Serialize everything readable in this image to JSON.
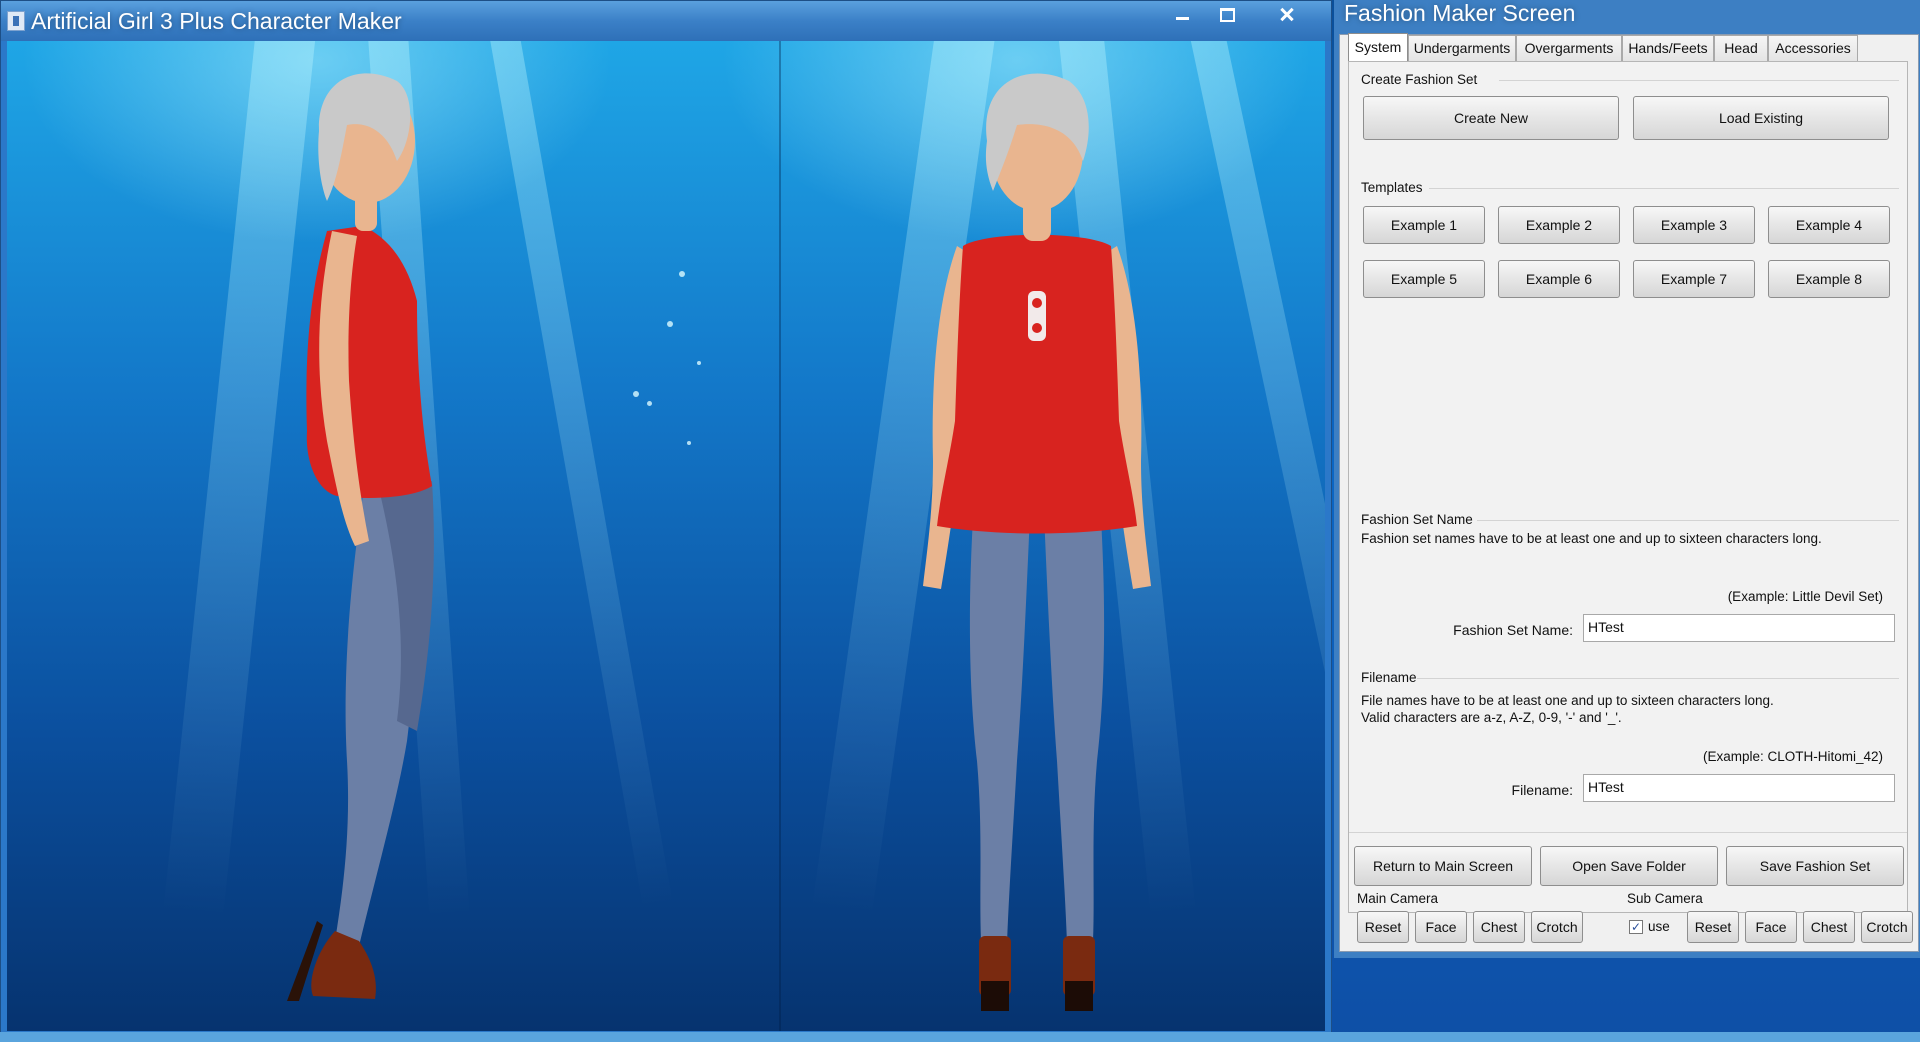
{
  "main_window": {
    "title": "Artificial Girl 3 Plus Character Maker"
  },
  "panel": {
    "title": "Fashion Maker Screen",
    "tabs": [
      {
        "label": "System",
        "active": true
      },
      {
        "label": "Undergarments",
        "active": false
      },
      {
        "label": "Overgarments",
        "active": false
      },
      {
        "label": "Hands/Feets",
        "active": false
      },
      {
        "label": "Head",
        "active": false
      },
      {
        "label": "Accessories",
        "active": false
      }
    ],
    "create_group": {
      "label": "Create Fashion Set",
      "create_new": "Create New",
      "load_existing": "Load Existing"
    },
    "templates": {
      "label": "Templates",
      "buttons": [
        "Example 1",
        "Example 2",
        "Example 3",
        "Example 4",
        "Example 5",
        "Example 6",
        "Example 7",
        "Example 8"
      ]
    },
    "fashion_set_name": {
      "group_label": "Fashion Set Name",
      "description": "Fashion set names have to be at least one and up to sixteen characters long.",
      "example": "(Example: Little Devil Set)",
      "field_label": "Fashion Set Name:",
      "value": "HTest"
    },
    "filename": {
      "group_label": "Filename",
      "description_line1": "File names have to be at least one and up to sixteen characters long.",
      "description_line2": "Valid characters are a-z, A-Z, 0-9, '-' and '_'.",
      "example": "(Example: CLOTH-Hitomi_42)",
      "field_label": "Filename:",
      "value": "HTest"
    },
    "actions": {
      "return_main": "Return to Main Screen",
      "open_folder": "Open Save Folder",
      "save_set": "Save Fashion Set"
    },
    "main_camera": {
      "label": "Main Camera",
      "buttons": [
        "Reset",
        "Face",
        "Chest",
        "Crotch"
      ]
    },
    "sub_camera": {
      "label": "Sub Camera",
      "use_label": "use",
      "use_checked": true,
      "buttons": [
        "Reset",
        "Face",
        "Chest",
        "Crotch"
      ]
    }
  },
  "colors": {
    "top_red": "#d8231f",
    "jeans_blue": "#6b7fa6",
    "skin": "#e9b58f",
    "hair_silver": "#c9c9c9"
  }
}
